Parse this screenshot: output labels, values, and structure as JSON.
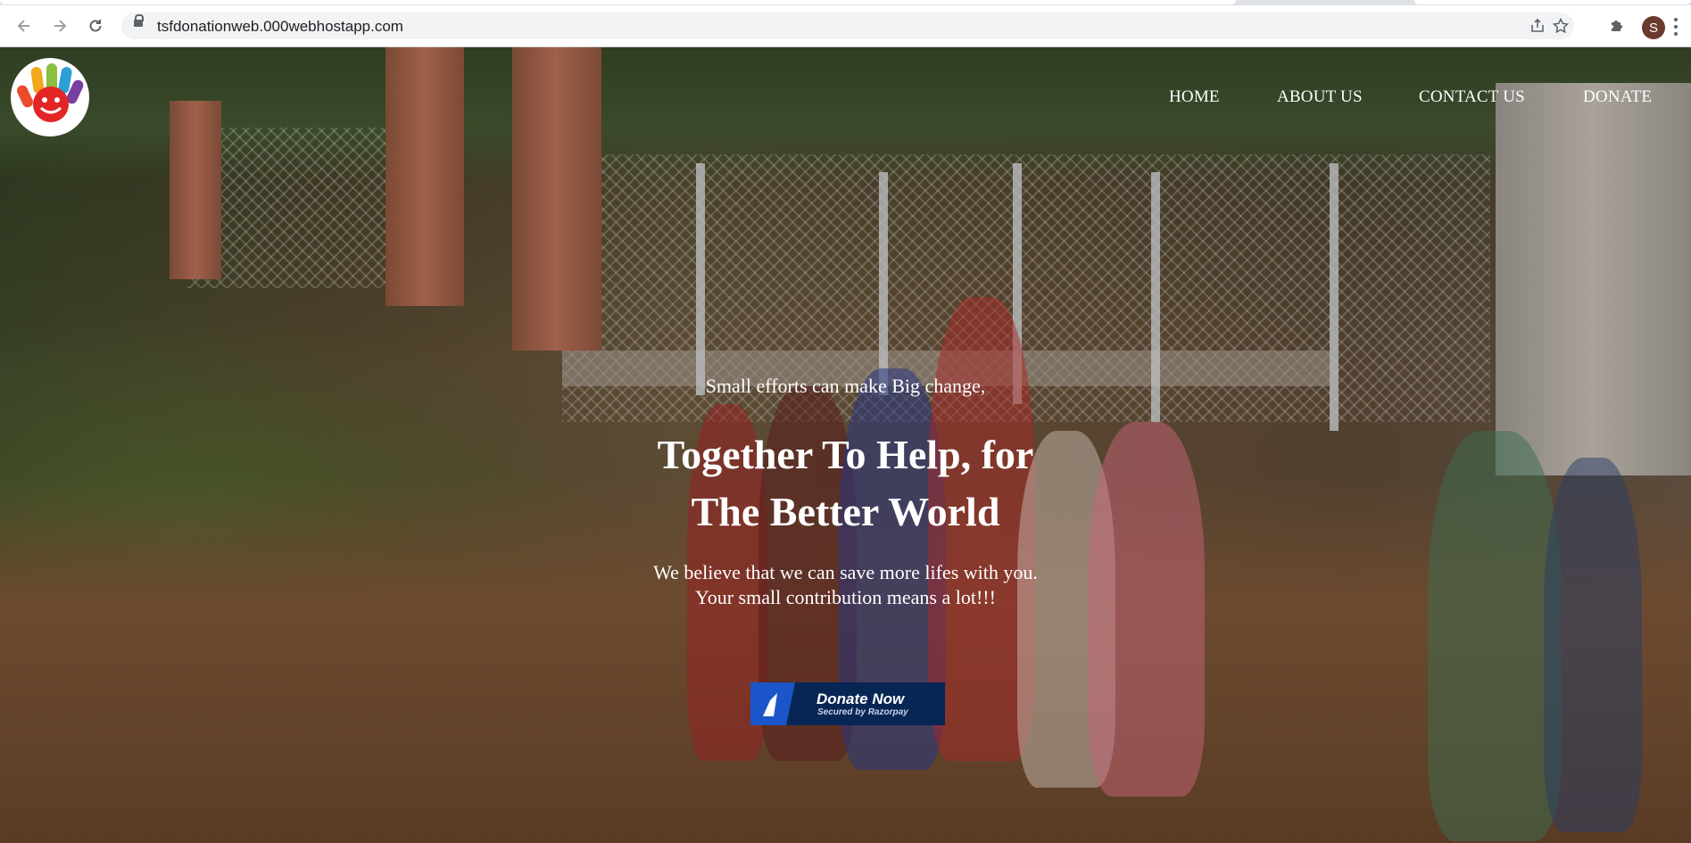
{
  "browser": {
    "url": "tsfdonationweb.000webhostapp.com",
    "profile_initial": "S",
    "icons": {
      "back": "back-arrow-icon",
      "forward": "forward-arrow-icon",
      "reload": "reload-icon",
      "lock": "lock-icon",
      "share": "share-icon",
      "bookmark": "star-icon",
      "extensions": "puzzle-icon",
      "menu": "kebab-menu-icon"
    }
  },
  "site": {
    "logo": "hand-smiley-logo",
    "nav": {
      "home": "HOME",
      "about": "ABOUT US",
      "contact": "CONTACT US",
      "donate": "DONATE"
    },
    "hero": {
      "tagline": "Small efforts can make Big change,",
      "headline_line1": "Together To Help, for",
      "headline_line2": "The Better World",
      "sub_line1": "We believe that we can save more lifes with you.",
      "sub_line2": "Your small contribution means a lot!!!"
    },
    "donate_button": {
      "title": "Donate Now",
      "subtitle": "Secured by Razorpay"
    }
  },
  "colors": {
    "donate_bg": "#072654",
    "donate_accent": "#1a56c9",
    "nav_text": "#ffffff"
  }
}
